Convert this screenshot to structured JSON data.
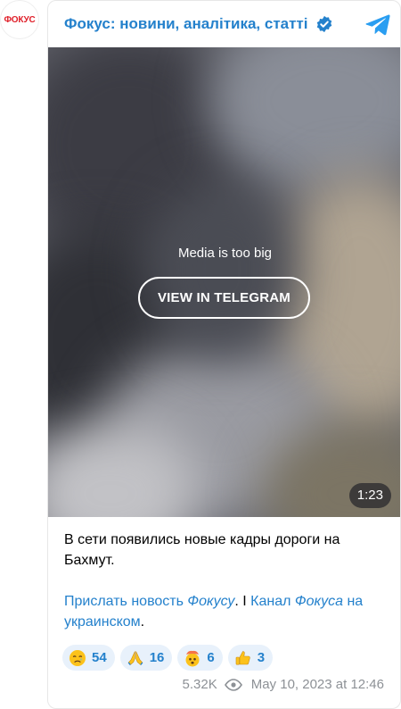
{
  "channel": {
    "avatar_text": "ФОКУС",
    "title": "Фокус: новини, аналітика, статті",
    "verified_icon": "verified-badge-icon",
    "telegram_icon": "telegram-icon"
  },
  "media": {
    "message": "Media is too big",
    "button_label": "VIEW IN TELEGRAM",
    "duration": "1:23"
  },
  "post": {
    "headline": "В сети появились новые кадры дороги на Бахмут.",
    "link1_prefix": "Прислать новость ",
    "link1_italic": "Фокусу",
    "after_link1": ". I ",
    "link2_prefix": "Канал",
    "link2_italic": "Фокуса",
    "link2_suffix": " на украинском",
    "end": "."
  },
  "reactions": [
    {
      "emoji": "crying-face-icon",
      "count": "54"
    },
    {
      "emoji": "folded-hands-icon",
      "count": "16"
    },
    {
      "emoji": "exploding-head-icon",
      "count": "6"
    },
    {
      "emoji": "thumbs-up-icon",
      "count": "3"
    }
  ],
  "meta": {
    "views": "5.32K",
    "date": "May 10, 2023 at 12:46"
  },
  "colors": {
    "accent": "#2481cc",
    "brand_red": "#e0202a",
    "reaction_bg": "#e8f1fb",
    "meta_gray": "#8d9196"
  }
}
